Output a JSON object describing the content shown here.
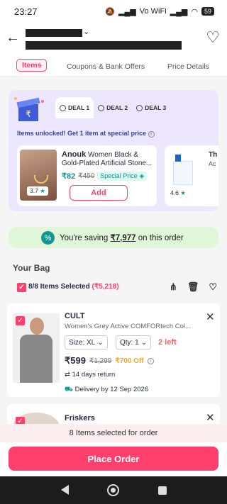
{
  "status": {
    "time": "23:27",
    "battery": "59",
    "wifi_label": "Vo WiFi"
  },
  "tabs": {
    "items": "Items",
    "coupons": "Coupons & Bank Offers",
    "price": "Price Details"
  },
  "deals": {
    "tabs": [
      "DEAL 1",
      "DEAL 2",
      "DEAL 3"
    ],
    "unlocked": "Items unlocked! Get 1 item at special price",
    "item1": {
      "brand": "Anouk",
      "name_part": "Women Black &",
      "name_line2": "Gold-Plated Artificial Stone...",
      "price": "₹82",
      "mrp": "₹450",
      "badge": "Special Price",
      "rating": "3.7",
      "add": "Add"
    },
    "item2": {
      "title": "Th",
      "sub": "Ac",
      "rating": "4.6"
    }
  },
  "saving": {
    "prefix": "You're saving ",
    "amount": "₹7,977",
    "suffix": " on this order"
  },
  "bag": {
    "title": "Your Bag",
    "selected": "8/8 Items Selected",
    "selected_price": "(₹5,218)"
  },
  "item": {
    "brand": "CULT",
    "name": "Women's Grey Active COMFORtech Col...",
    "size": "Size: XL",
    "qty": "Qty: 1",
    "left": "2 left",
    "price": "₹599",
    "mrp": "₹1,299",
    "off": "₹700 Off",
    "returns": "14 days return",
    "delivery": "Delivery by 12 Sep 2026"
  },
  "item2": {
    "brand": "Friskers"
  },
  "selection_bar": "8 Items selected for order",
  "place_order": "Place Order"
}
